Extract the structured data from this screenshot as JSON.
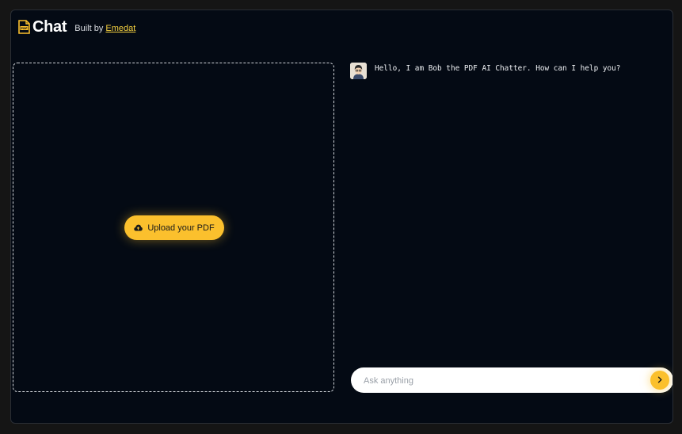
{
  "header": {
    "app_name": "Chat",
    "built_by_prefix": "Built by",
    "built_by_link": "Emedat"
  },
  "upload": {
    "button_label": "Upload your PDF"
  },
  "chat": {
    "messages": [
      {
        "sender": "bot",
        "text": "Hello, I am Bob the PDF AI Chatter. How can I help you?"
      }
    ]
  },
  "input": {
    "placeholder": "Ask anything",
    "value": ""
  },
  "colors": {
    "background": "#040a14",
    "accent": "#fbc02d",
    "link": "#f4d03f",
    "text": "#eef0f3"
  },
  "icons": {
    "logo": "pdf-file-icon",
    "upload": "cloud-upload-icon",
    "send": "chevron-right-icon",
    "avatar": "bot-avatar"
  }
}
